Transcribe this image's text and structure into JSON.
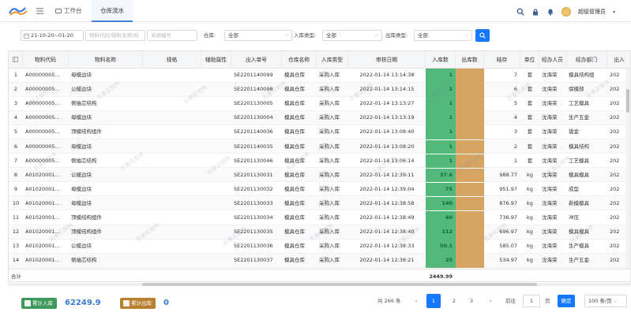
{
  "header": {
    "tabs": [
      {
        "label": "工作台"
      },
      {
        "label": "仓库流水"
      }
    ],
    "user_name": "超级管理员"
  },
  "filters": {
    "date_range": "21-10-20~01-20",
    "material_placeholder": "物料代码/物料名称/规",
    "doc_placeholder": "单据编号",
    "warehouse_label": "仓库:",
    "warehouse_value": "全部",
    "in_type_label": "入库类型:",
    "in_type_value": "全部",
    "out_type_label": "出库类型:",
    "out_type_value": "全部"
  },
  "columns": [
    "物料代码",
    "物料名称",
    "规格",
    "辅助属性",
    "出入单号",
    "仓库名称",
    "入库类型",
    "审核日期",
    "入库数",
    "出库数",
    "结存",
    "单位",
    "经办人员",
    "经办部门",
    "出入"
  ],
  "rows": [
    {
      "n": "1",
      "code": "A00000005...",
      "name": "母模边块",
      "spec": "",
      "attr": "",
      "doc": "SE2201140099",
      "wh": "模具仓库",
      "type": "采购入库",
      "date": "2022-01-14 13:14:38",
      "in": "1",
      "out": "",
      "bal": "7",
      "unit": "套",
      "staff": "沈海荣",
      "dept": "模具结构组",
      "x": "202"
    },
    {
      "n": "2",
      "code": "A00000005...",
      "name": "公模边块",
      "spec": "",
      "attr": "",
      "doc": "SE2201140098",
      "wh": "模具仓库",
      "type": "采购入库",
      "date": "2022-01-14 13:14:15",
      "in": "1",
      "out": "",
      "bal": "6",
      "unit": "套",
      "staff": "沈海荣",
      "dept": "保模部",
      "x": "202"
    },
    {
      "n": "3",
      "code": "A00000005...",
      "name": "侧抽芯结构",
      "spec": "",
      "attr": "",
      "doc": "SE2201130005",
      "wh": "模具仓库",
      "type": "采购入库",
      "date": "2022-01-14 13:13:27",
      "in": "1",
      "out": "",
      "bal": "5",
      "unit": "套",
      "staff": "沈海荣",
      "dept": "工艺模具",
      "x": "202"
    },
    {
      "n": "4",
      "code": "A00000005...",
      "name": "母模边块",
      "spec": "",
      "attr": "",
      "doc": "SE2201130004",
      "wh": "模具仓库",
      "type": "采购入库",
      "date": "2022-01-14 13:13:19",
      "in": "1",
      "out": "",
      "bal": "4",
      "unit": "套",
      "staff": "沈海荣",
      "dept": "生产五金",
      "x": "202"
    },
    {
      "n": "5",
      "code": "A00000005...",
      "name": "顶模结构组件",
      "spec": "",
      "attr": "",
      "doc": "SE2201140036",
      "wh": "模具仓库",
      "type": "采购入库",
      "date": "2022-01-14 13:08:40",
      "in": "1",
      "out": "",
      "bal": "3",
      "unit": "套",
      "staff": "沈海荣",
      "dept": "钣金",
      "x": "202"
    },
    {
      "n": "6",
      "code": "A00000005...",
      "name": "母模边块",
      "spec": "",
      "attr": "",
      "doc": "SE2201140035",
      "wh": "模具仓库",
      "type": "采购入库",
      "date": "2022-01-14 13:08:20",
      "in": "1",
      "out": "",
      "bal": "2",
      "unit": "套",
      "staff": "沈海荣",
      "dept": "模具结构",
      "x": "202"
    },
    {
      "n": "7",
      "code": "A00000005...",
      "name": "侧抽芯结构",
      "spec": "",
      "attr": "",
      "doc": "SE2201130046",
      "wh": "模具仓库",
      "type": "采购入库",
      "date": "2022-01-14 13:06:14",
      "in": "1",
      "out": "",
      "bal": "1",
      "unit": "套",
      "staff": "沈海荣",
      "dept": "工艺模具",
      "x": "202"
    },
    {
      "n": "8",
      "code": "A01020001...",
      "name": "公模边块",
      "spec": "",
      "attr": "",
      "doc": "SE2201130031",
      "wh": "模具仓库",
      "type": "采购入库",
      "date": "2022-01-14 12:39:11",
      "in": "37.6",
      "out": "",
      "bal": "988.77",
      "unit": "kg",
      "staff": "沈海荣",
      "dept": "模具模具",
      "x": "202"
    },
    {
      "n": "9",
      "code": "A01020001...",
      "name": "母模边块",
      "spec": "",
      "attr": "",
      "doc": "SE2201130032",
      "wh": "模具仓库",
      "type": "采购入库",
      "date": "2022-01-14 12:39:04",
      "in": "75",
      "out": "",
      "bal": "951.97",
      "unit": "kg",
      "staff": "沈海荣",
      "dept": "成型",
      "x": "202"
    },
    {
      "n": "10",
      "code": "A01020001...",
      "name": "母模边块",
      "spec": "",
      "attr": "",
      "doc": "SE2201130033",
      "wh": "模具仓库",
      "type": "采购入库",
      "date": "2022-01-14 12:38:58",
      "in": "140",
      "out": "",
      "bal": "876.97",
      "unit": "kg",
      "staff": "沈海荣",
      "dept": "新模模具",
      "x": "202"
    },
    {
      "n": "11",
      "code": "A01020001...",
      "name": "顶模结构组件",
      "spec": "",
      "attr": "",
      "doc": "SE2201130034",
      "wh": "模具仓库",
      "type": "采购入库",
      "date": "2022-01-14 12:38:49",
      "in": "40",
      "out": "",
      "bal": "736.97",
      "unit": "kg",
      "staff": "沈海荣",
      "dept": "冲压",
      "x": "202"
    },
    {
      "n": "12",
      "code": "A01020001...",
      "name": "顶模结构组件",
      "spec": "",
      "attr": "",
      "doc": "SE2201130035",
      "wh": "模具仓库",
      "type": "采购入库",
      "date": "2022-01-14 12:38:40",
      "in": "112",
      "out": "",
      "bal": "696.97",
      "unit": "kg",
      "staff": "沈海荣",
      "dept": "模具模具",
      "x": "202"
    },
    {
      "n": "13",
      "code": "A01020001...",
      "name": "公模边块",
      "spec": "",
      "attr": "",
      "doc": "SE2201130036",
      "wh": "模具仓库",
      "type": "采购入库",
      "date": "2022-01-14 12:38:33",
      "in": "50.1",
      "out": "",
      "bal": "585.07",
      "unit": "kg",
      "staff": "沈海荣",
      "dept": "生产模具",
      "x": "202"
    },
    {
      "n": "14",
      "code": "A01020001...",
      "name": "侧抽芯结构",
      "spec": "",
      "attr": "",
      "doc": "SE2201130037",
      "wh": "模具仓库",
      "type": "采购入库",
      "date": "2022-01-14 12:38:21",
      "in": "25",
      "out": "",
      "bal": "534.97",
      "unit": "kg",
      "staff": "沈海荣",
      "dept": "生产五金",
      "x": "202"
    }
  ],
  "totals": {
    "label": "合计",
    "in": "2449.99"
  },
  "footer": {
    "total_in_label": "累计入库",
    "total_in_value": "62249.9",
    "total_out_label": "累计出库",
    "total_out_value": "0",
    "record_count": "共 266 条",
    "pages": [
      "1",
      "2",
      "3"
    ],
    "goto_label": "前往",
    "goto_value": "1",
    "page_unit": "页",
    "confirm": "确定",
    "page_size": "100 条/页"
  },
  "watermark": "云易云软件",
  "colors": {
    "in_cell": "#52b97b",
    "out_cell": "#d7a563",
    "primary": "#1677ff"
  }
}
